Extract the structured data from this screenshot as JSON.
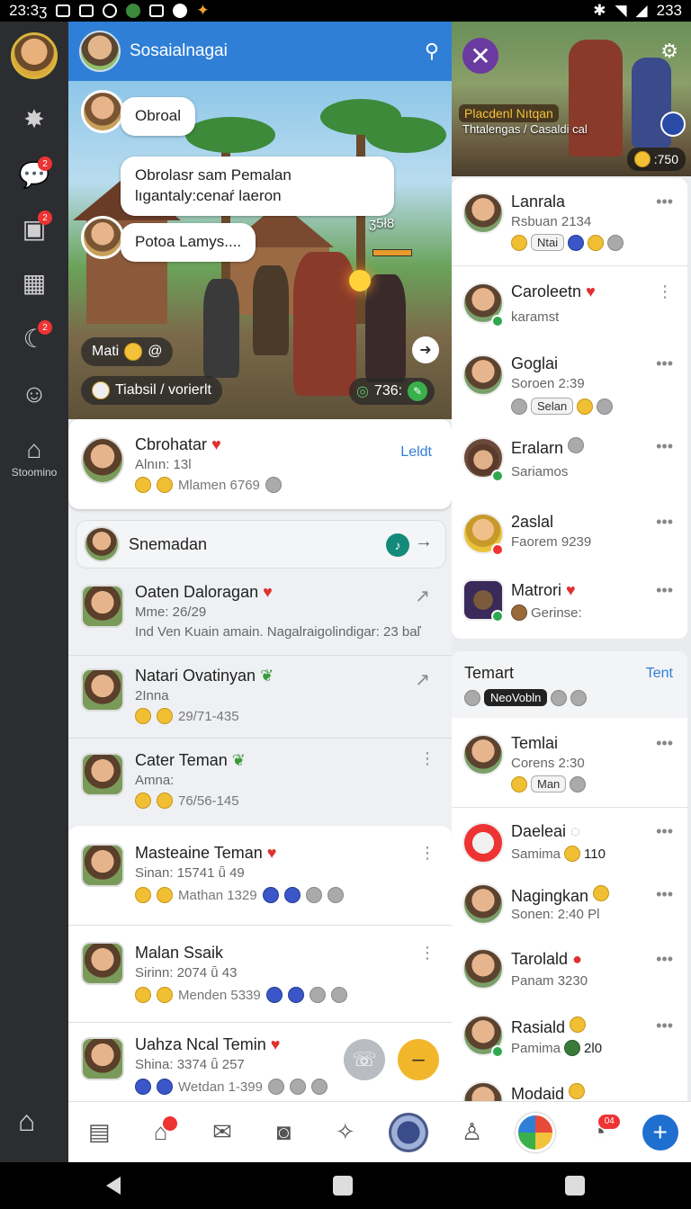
{
  "status_bar": {
    "time": "23:3ʒ",
    "right_text": "233"
  },
  "rail": {
    "items": [
      {
        "icon": "star-icon"
      },
      {
        "icon": "chat-icon",
        "badge": "2"
      },
      {
        "icon": "camera-icon",
        "badge": "2"
      },
      {
        "icon": "grid-icon"
      },
      {
        "icon": "moon-icon",
        "badge": "2"
      },
      {
        "icon": "smiley-icon"
      }
    ],
    "streaming_label": "Stoomino"
  },
  "chat": {
    "header_title": "Sosaialnagai",
    "messages": [
      {
        "text": "Obroal"
      },
      {
        "text": "Obrolasr sam Pemalan lıgantaly:cenaŕ laeron"
      },
      {
        "text": "Potoa Lamys...."
      }
    ],
    "scene_counter": "ʒ5ł8",
    "pill_main": "Mati",
    "pill_translate": "Tiabsil / vorierlt",
    "scene_score": "736:"
  },
  "list": {
    "featured": {
      "name": "Cbrohatar",
      "sub": "Alnın: 13l",
      "meta": "Mlamen 6769",
      "action": "Leldt"
    },
    "search_row": {
      "name": "Snemadan"
    },
    "rows": [
      {
        "name": "Oaten Daloragan",
        "sub": "Mme: 26/29",
        "meta": "Ind Ven Kuain amain. Nagalraigolindigar: 23 baľ"
      },
      {
        "name": "Natari Ovatinyan",
        "sub": "2Inna",
        "meta": "29/71-435"
      },
      {
        "name": "Cater Teman",
        "sub": "Amna:",
        "meta": "76/56-145"
      },
      {
        "name": "Masteaine Teman",
        "sub": "Sinan: 15741 ǖ 49",
        "meta": "Mathan 1329"
      },
      {
        "name": "Malan Ssaik",
        "sub": "Sirinn: 2074 ǖ 43",
        "meta": "Menden 5339"
      },
      {
        "name": "Uahza Ncal Temin",
        "sub": "Shina: 3374 ǖ 257",
        "meta": "Wetdan 1-399"
      }
    ]
  },
  "right": {
    "thumb_title": "Placdenl Nıtqan",
    "thumb_sub": "Thtalengas / Casaldi cal",
    "thumb_score": ":750",
    "players": [
      {
        "name": "Lanrala",
        "sub": "Rsbuan 2134",
        "tag": "Ntai"
      },
      {
        "name": "Caroleetn",
        "sub": "karamst"
      },
      {
        "name": "Goglai",
        "sub": "Soroen 2:39",
        "tag": "Selan"
      },
      {
        "name": "Eralarn",
        "sub": "Sariamos"
      },
      {
        "name": "2aslal",
        "sub": "Faorem 9239"
      },
      {
        "name": "Matrori",
        "sub": "Gerinse:"
      }
    ],
    "friends_title": "Temart",
    "friends_action": "Tent",
    "friends_tag": "NeoVobln",
    "friends": [
      {
        "name": "Temlai",
        "sub": "Corens 2:30",
        "tag": "Man"
      },
      {
        "name": "Daeleai",
        "sub": "Samima",
        "extra": "110"
      },
      {
        "name": "Nagingkan",
        "sub": "Sonen: 2:40 Pl"
      },
      {
        "name": "Tarolald",
        "sub": "Panam 3230"
      },
      {
        "name": "Rasiald",
        "sub": "Pamima",
        "extra": "2l0"
      },
      {
        "name": "Modaid",
        "sub": ""
      }
    ]
  },
  "navbar": {
    "badge": "04"
  },
  "colors": {
    "header": "#2f7fd6",
    "rail": "#2b2d31",
    "accent": "#1f6fd1"
  }
}
